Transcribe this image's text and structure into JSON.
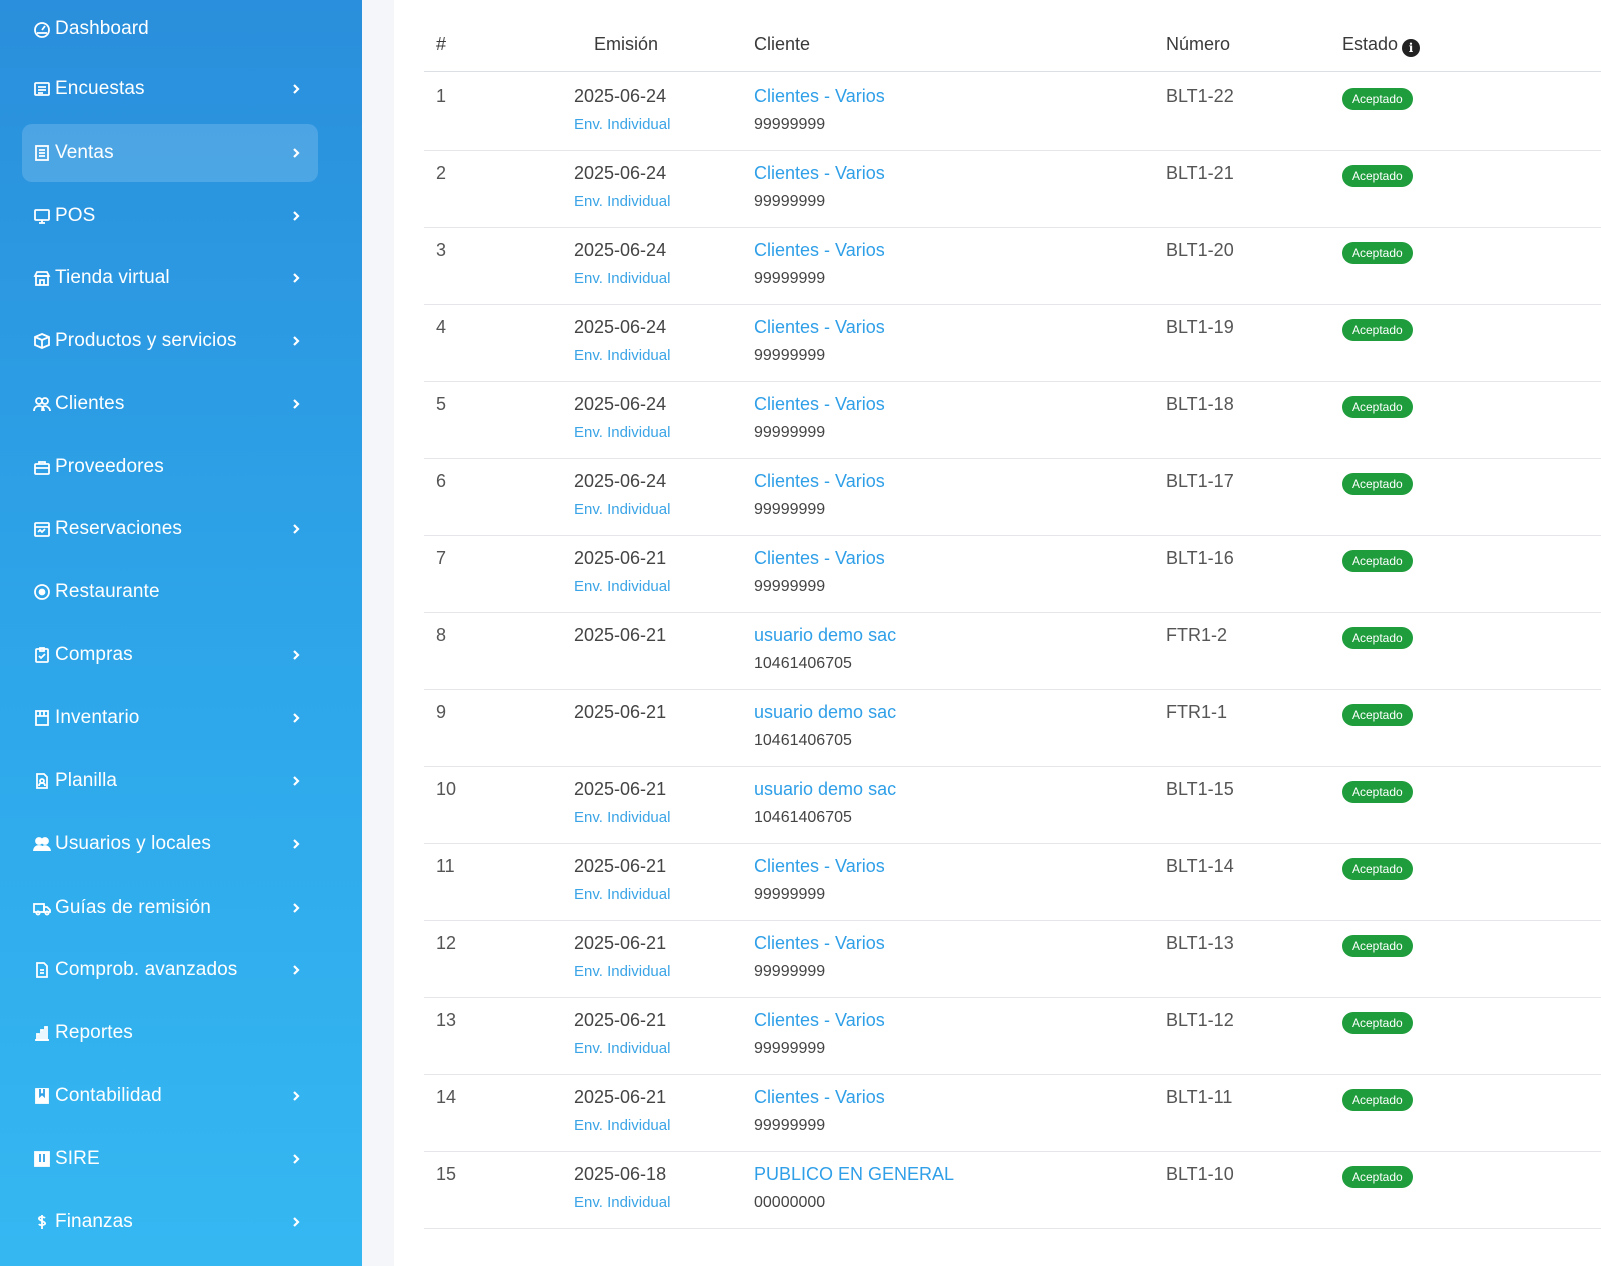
{
  "sidebar": {
    "items": [
      {
        "label": "Dashboard",
        "icon": "dashboard-icon",
        "chevron": false
      },
      {
        "label": "Encuestas",
        "icon": "survey-icon",
        "chevron": true
      },
      {
        "label": "Ventas",
        "icon": "sales-icon",
        "chevron": true,
        "active": true
      },
      {
        "label": "POS",
        "icon": "monitor-icon",
        "chevron": true
      },
      {
        "label": "Tienda virtual",
        "icon": "store-icon",
        "chevron": true
      },
      {
        "label": "Productos y servicios",
        "icon": "box-icon",
        "chevron": true
      },
      {
        "label": "Clientes",
        "icon": "users-icon",
        "chevron": true
      },
      {
        "label": "Proveedores",
        "icon": "briefcase-icon",
        "chevron": false
      },
      {
        "label": "Reservaciones",
        "icon": "calendar-icon",
        "chevron": true
      },
      {
        "label": "Restaurante",
        "icon": "record-icon",
        "chevron": false
      },
      {
        "label": "Compras",
        "icon": "clipboard-check-icon",
        "chevron": true
      },
      {
        "label": "Inventario",
        "icon": "inventory-icon",
        "chevron": true
      },
      {
        "label": "Planilla",
        "icon": "file-person-icon",
        "chevron": true
      },
      {
        "label": "Usuarios y locales",
        "icon": "people-icon",
        "chevron": true
      },
      {
        "label": "Guías de remisión",
        "icon": "truck-icon",
        "chevron": true
      },
      {
        "label": "Comprob. avanzados",
        "icon": "document-icon",
        "chevron": true
      },
      {
        "label": "Reportes",
        "icon": "bar-chart-icon",
        "chevron": false
      },
      {
        "label": "Contabilidad",
        "icon": "ledger-icon",
        "chevron": true
      },
      {
        "label": "SIRE",
        "icon": "sire-icon",
        "chevron": true
      },
      {
        "label": "Finanzas",
        "icon": "dollar-icon",
        "chevron": true
      }
    ]
  },
  "table": {
    "headers": {
      "num": "#",
      "emision": "Emisión",
      "cliente": "Cliente",
      "numero": "Número",
      "estado": "Estado"
    },
    "rows": [
      {
        "num": "1",
        "date": "2025-06-24",
        "env": "Env. Individual",
        "client": "Clientes - Varios",
        "doc": "99999999",
        "numero": "BLT1-22",
        "estado": "Aceptado"
      },
      {
        "num": "2",
        "date": "2025-06-24",
        "env": "Env. Individual",
        "client": "Clientes - Varios",
        "doc": "99999999",
        "numero": "BLT1-21",
        "estado": "Aceptado"
      },
      {
        "num": "3",
        "date": "2025-06-24",
        "env": "Env. Individual",
        "client": "Clientes - Varios",
        "doc": "99999999",
        "numero": "BLT1-20",
        "estado": "Aceptado"
      },
      {
        "num": "4",
        "date": "2025-06-24",
        "env": "Env. Individual",
        "client": "Clientes - Varios",
        "doc": "99999999",
        "numero": "BLT1-19",
        "estado": "Aceptado"
      },
      {
        "num": "5",
        "date": "2025-06-24",
        "env": "Env. Individual",
        "client": "Clientes - Varios",
        "doc": "99999999",
        "numero": "BLT1-18",
        "estado": "Aceptado"
      },
      {
        "num": "6",
        "date": "2025-06-24",
        "env": "Env. Individual",
        "client": "Clientes - Varios",
        "doc": "99999999",
        "numero": "BLT1-17",
        "estado": "Aceptado"
      },
      {
        "num": "7",
        "date": "2025-06-21",
        "env": "Env. Individual",
        "client": "Clientes - Varios",
        "doc": "99999999",
        "numero": "BLT1-16",
        "estado": "Aceptado"
      },
      {
        "num": "8",
        "date": "2025-06-21",
        "env": "",
        "client": "usuario demo sac",
        "doc": "10461406705",
        "numero": "FTR1-2",
        "estado": "Aceptado"
      },
      {
        "num": "9",
        "date": "2025-06-21",
        "env": "",
        "client": "usuario demo sac",
        "doc": "10461406705",
        "numero": "FTR1-1",
        "estado": "Aceptado"
      },
      {
        "num": "10",
        "date": "2025-06-21",
        "env": "Env. Individual",
        "client": "usuario demo sac",
        "doc": "10461406705",
        "numero": "BLT1-15",
        "estado": "Aceptado"
      },
      {
        "num": "11",
        "date": "2025-06-21",
        "env": "Env. Individual",
        "client": "Clientes - Varios",
        "doc": "99999999",
        "numero": "BLT1-14",
        "estado": "Aceptado"
      },
      {
        "num": "12",
        "date": "2025-06-21",
        "env": "Env. Individual",
        "client": "Clientes - Varios",
        "doc": "99999999",
        "numero": "BLT1-13",
        "estado": "Aceptado"
      },
      {
        "num": "13",
        "date": "2025-06-21",
        "env": "Env. Individual",
        "client": "Clientes - Varios",
        "doc": "99999999",
        "numero": "BLT1-12",
        "estado": "Aceptado"
      },
      {
        "num": "14",
        "date": "2025-06-21",
        "env": "Env. Individual",
        "client": "Clientes - Varios",
        "doc": "99999999",
        "numero": "BLT1-11",
        "estado": "Aceptado"
      },
      {
        "num": "15",
        "date": "2025-06-18",
        "env": "Env. Individual",
        "client": "PUBLICO EN GENERAL",
        "doc": "00000000",
        "numero": "BLT1-10",
        "estado": "Aceptado"
      }
    ]
  },
  "colors": {
    "sidebar_top": "#2a8fdc",
    "sidebar_bottom": "#35b8f2",
    "link": "#2f9fe8",
    "badge_success": "#1f9d3c"
  }
}
